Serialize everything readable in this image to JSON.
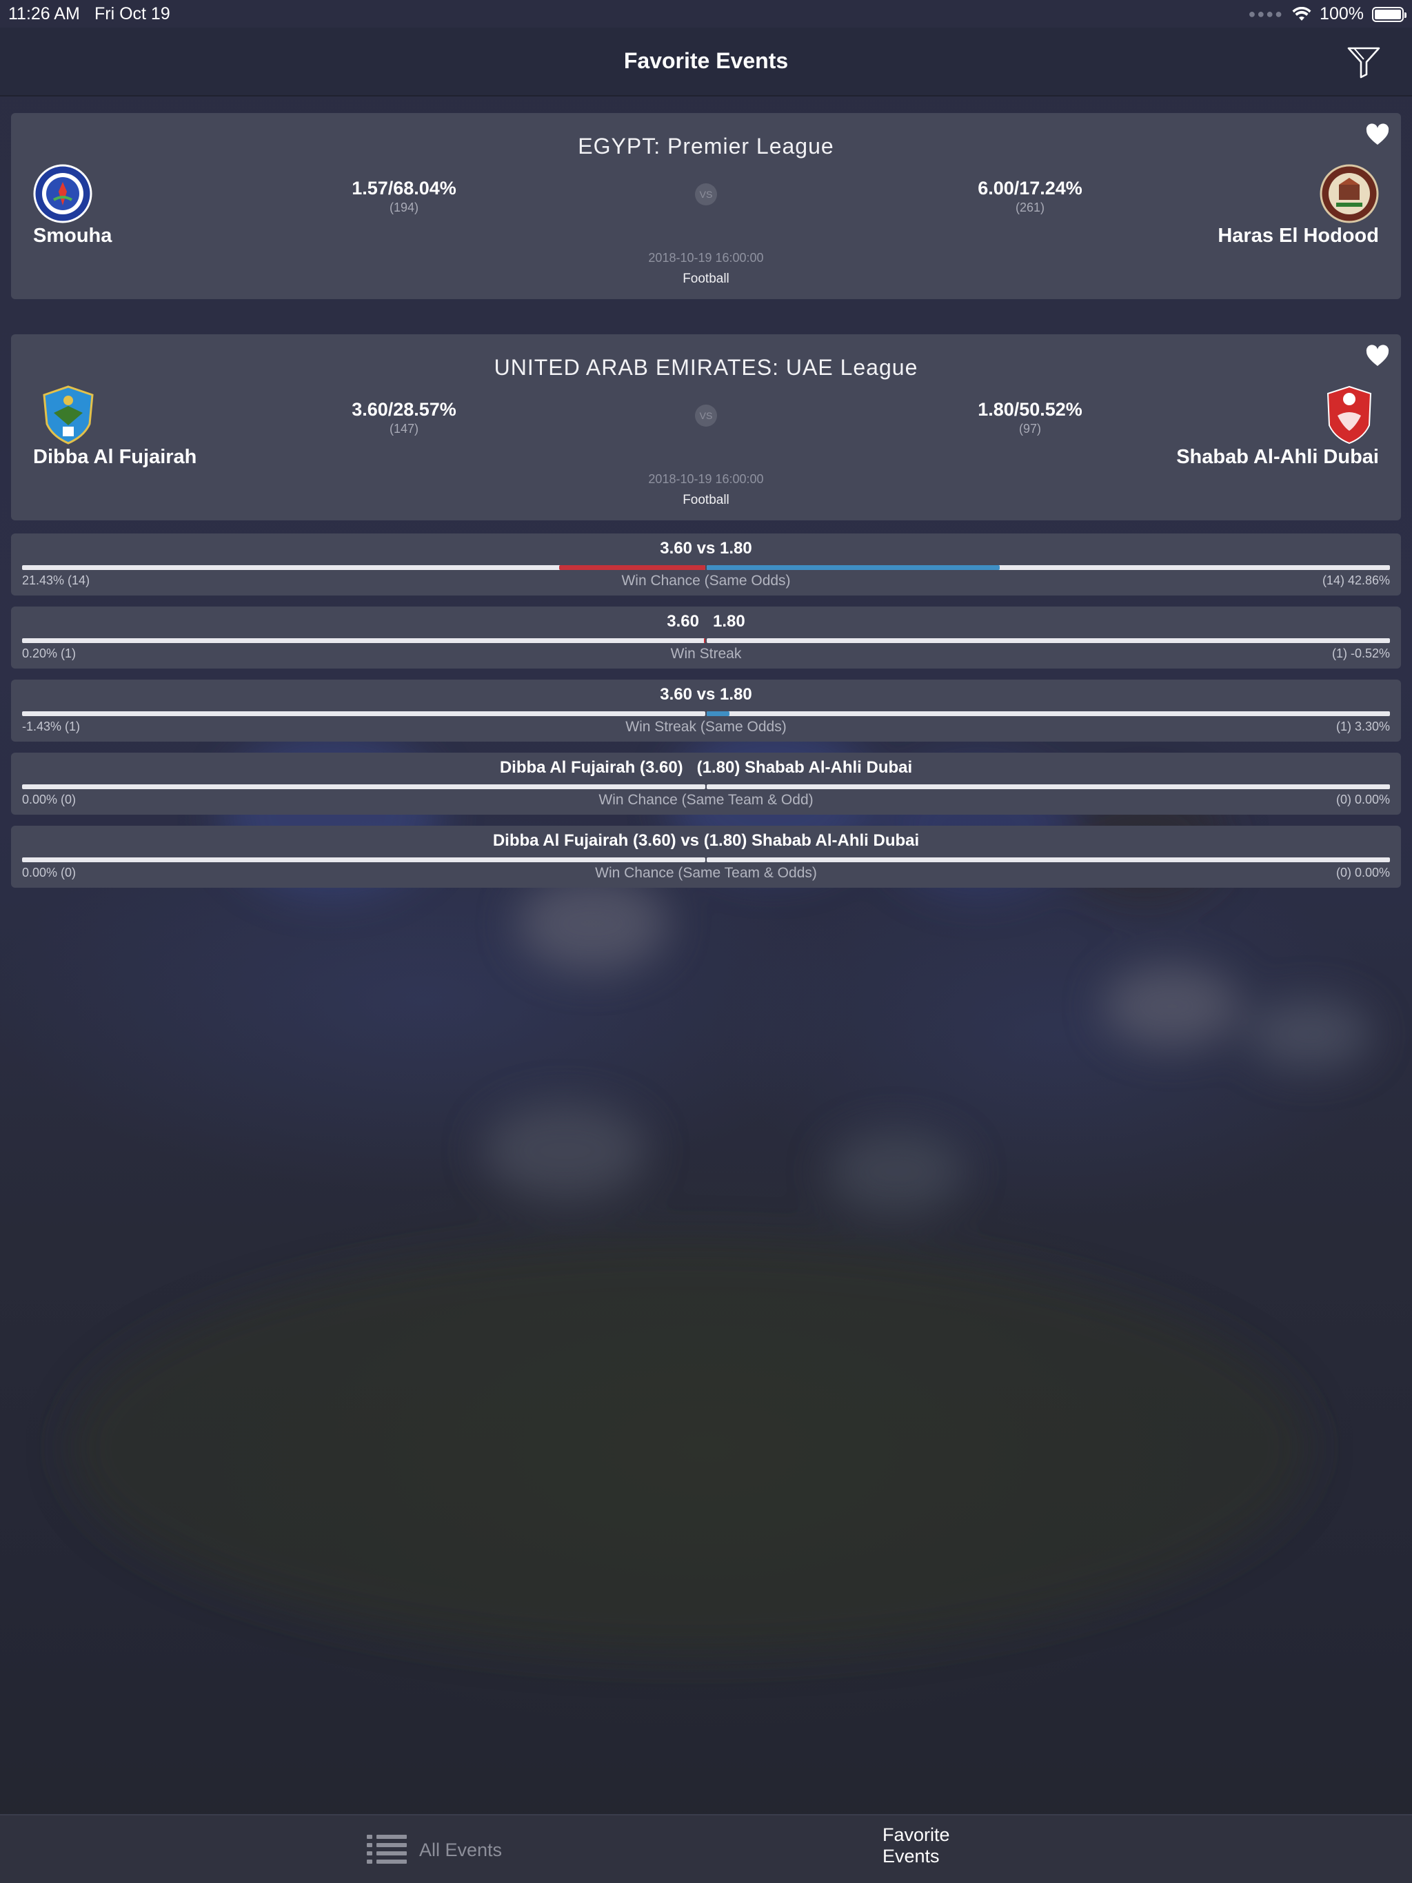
{
  "status_bar": {
    "time": "11:26 AM",
    "date": "Fri Oct 19",
    "battery": "100%"
  },
  "nav": {
    "title": "Favorite Events",
    "filter_icon": "filter-icon"
  },
  "events": [
    {
      "league": "EGYPT: Premier League",
      "home": {
        "name": "Smouha",
        "odds": "1.57/68.04%",
        "count": "(194)"
      },
      "away": {
        "name": "Haras El Hodood",
        "odds": "6.00/17.24%",
        "count": "(261)"
      },
      "vs": "VS",
      "datetime": "2018-10-19 16:00:00",
      "sport": "Football"
    },
    {
      "league": "UNITED ARAB EMIRATES: UAE League",
      "home": {
        "name": "Dibba Al Fujairah",
        "odds": "3.60/28.57%",
        "count": "(147)"
      },
      "away": {
        "name": "Shabab Al-Ahli Dubai",
        "odds": "1.80/50.52%",
        "count": "(97)"
      },
      "vs": "VS",
      "datetime": "2018-10-19 16:00:00",
      "sport": "Football"
    }
  ],
  "stats": [
    {
      "title": "3.60 vs 1.80",
      "left_value": "21.43% (14)",
      "right_value": "(14) 42.86%",
      "label": "Win Chance (Same Odds)",
      "left_fill": 0.214,
      "right_fill": 0.429
    },
    {
      "title": "3.60   1.80",
      "left_value": "0.20% (1)",
      "right_value": "(1) -0.52%",
      "label": "Win Streak",
      "left_fill": 0.002,
      "right_fill": 0.0
    },
    {
      "title": "3.60 vs 1.80",
      "left_value": "-1.43% (1)",
      "right_value": "(1) 3.30%",
      "label": "Win Streak (Same Odds)",
      "left_fill": 0.0,
      "right_fill": 0.033
    },
    {
      "title": "Dibba Al Fujairah (3.60)   (1.80) Shabab Al-Ahli Dubai",
      "left_value": "0.00% (0)",
      "right_value": "(0) 0.00%",
      "label": "Win Chance (Same Team & Odd)",
      "left_fill": 0.0,
      "right_fill": 0.0
    },
    {
      "title": "Dibba Al Fujairah (3.60) vs (1.80) Shabab Al-Ahli Dubai",
      "left_value": "0.00% (0)",
      "right_value": "(0) 0.00%",
      "label": "Win Chance (Same Team & Odds)",
      "left_fill": 0.0,
      "right_fill": 0.0
    }
  ],
  "tabs": [
    {
      "label": "All Events",
      "icon": "list-icon",
      "active": false
    },
    {
      "label": "Favorite Events",
      "icon": "heart-icon",
      "active": true
    }
  ],
  "colors": {
    "accent_red": "#c6323a",
    "accent_blue": "#3f8fc4",
    "card_bg": "#454859",
    "nav_bg": "#272a3d"
  }
}
